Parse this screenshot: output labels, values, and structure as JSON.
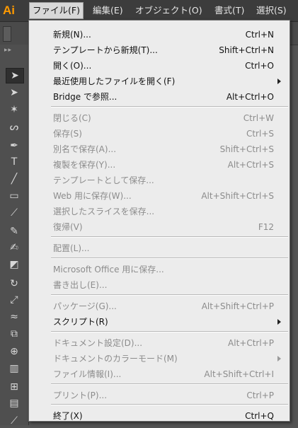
{
  "app": {
    "logo": "Ai"
  },
  "menubar": [
    {
      "label": "ファイル(F)",
      "active": true
    },
    {
      "label": "編集(E)",
      "active": false
    },
    {
      "label": "オブジェクト(O)",
      "active": false
    },
    {
      "label": "書式(T)",
      "active": false
    },
    {
      "label": "選択(S)",
      "active": false
    }
  ],
  "tools": [
    "selection-tool-icon",
    "direct-selection-tool-icon",
    "magic-wand-tool-icon",
    "lasso-tool-icon",
    "pen-tool-icon",
    "type-tool-icon",
    "line-segment-tool-icon",
    "rectangle-tool-icon",
    "paintbrush-tool-icon",
    "pencil-tool-icon",
    "blob-brush-tool-icon",
    "eraser-tool-icon",
    "rotate-tool-icon",
    "scale-tool-icon",
    "warp-tool-icon",
    "free-transform-tool-icon",
    "shape-builder-tool-icon",
    "graph-tool-icon",
    "mesh-tool-icon",
    "gradient-tool-icon",
    "eyedropper-tool-icon"
  ],
  "file_menu": {
    "items": [
      {
        "label": "新規(N)...",
        "shortcut": "Ctrl+N",
        "enabled": true
      },
      {
        "label": "テンプレートから新規(T)...",
        "shortcut": "Shift+Ctrl+N",
        "enabled": true
      },
      {
        "label": "開く(O)...",
        "shortcut": "Ctrl+O",
        "enabled": true
      },
      {
        "label": "最近使用したファイルを開く(F)",
        "shortcut": "",
        "enabled": true,
        "submenu": true
      },
      {
        "label": "Bridge で参照...",
        "shortcut": "Alt+Ctrl+O",
        "enabled": true
      },
      {
        "separator": true
      },
      {
        "label": "閉じる(C)",
        "shortcut": "Ctrl+W",
        "enabled": false
      },
      {
        "label": "保存(S)",
        "shortcut": "Ctrl+S",
        "enabled": false
      },
      {
        "label": "別名で保存(A)...",
        "shortcut": "Shift+Ctrl+S",
        "enabled": false
      },
      {
        "label": "複製を保存(Y)...",
        "shortcut": "Alt+Ctrl+S",
        "enabled": false
      },
      {
        "label": "テンプレートとして保存...",
        "shortcut": "",
        "enabled": false
      },
      {
        "label": "Web 用に保存(W)...",
        "shortcut": "Alt+Shift+Ctrl+S",
        "enabled": false
      },
      {
        "label": "選択したスライスを保存...",
        "shortcut": "",
        "enabled": false
      },
      {
        "label": "復帰(V)",
        "shortcut": "F12",
        "enabled": false
      },
      {
        "separator": true
      },
      {
        "label": "配置(L)...",
        "shortcut": "",
        "enabled": false
      },
      {
        "separator": true
      },
      {
        "label": "Microsoft Office 用に保存...",
        "shortcut": "",
        "enabled": false
      },
      {
        "label": "書き出し(E)...",
        "shortcut": "",
        "enabled": false
      },
      {
        "separator": true
      },
      {
        "label": "パッケージ(G)...",
        "shortcut": "Alt+Shift+Ctrl+P",
        "enabled": false
      },
      {
        "label": "スクリプト(R)",
        "shortcut": "",
        "enabled": true,
        "submenu": true
      },
      {
        "separator": true
      },
      {
        "label": "ドキュメント設定(D)...",
        "shortcut": "Alt+Ctrl+P",
        "enabled": false
      },
      {
        "label": "ドキュメントのカラーモード(M)",
        "shortcut": "",
        "enabled": false,
        "submenu": true
      },
      {
        "label": "ファイル情報(I)...",
        "shortcut": "Alt+Shift+Ctrl+I",
        "enabled": false
      },
      {
        "separator": true
      },
      {
        "label": "プリント(P)...",
        "shortcut": "Ctrl+P",
        "enabled": false
      },
      {
        "separator": true
      },
      {
        "label": "終了(X)",
        "shortcut": "Ctrl+Q",
        "enabled": true
      }
    ]
  }
}
